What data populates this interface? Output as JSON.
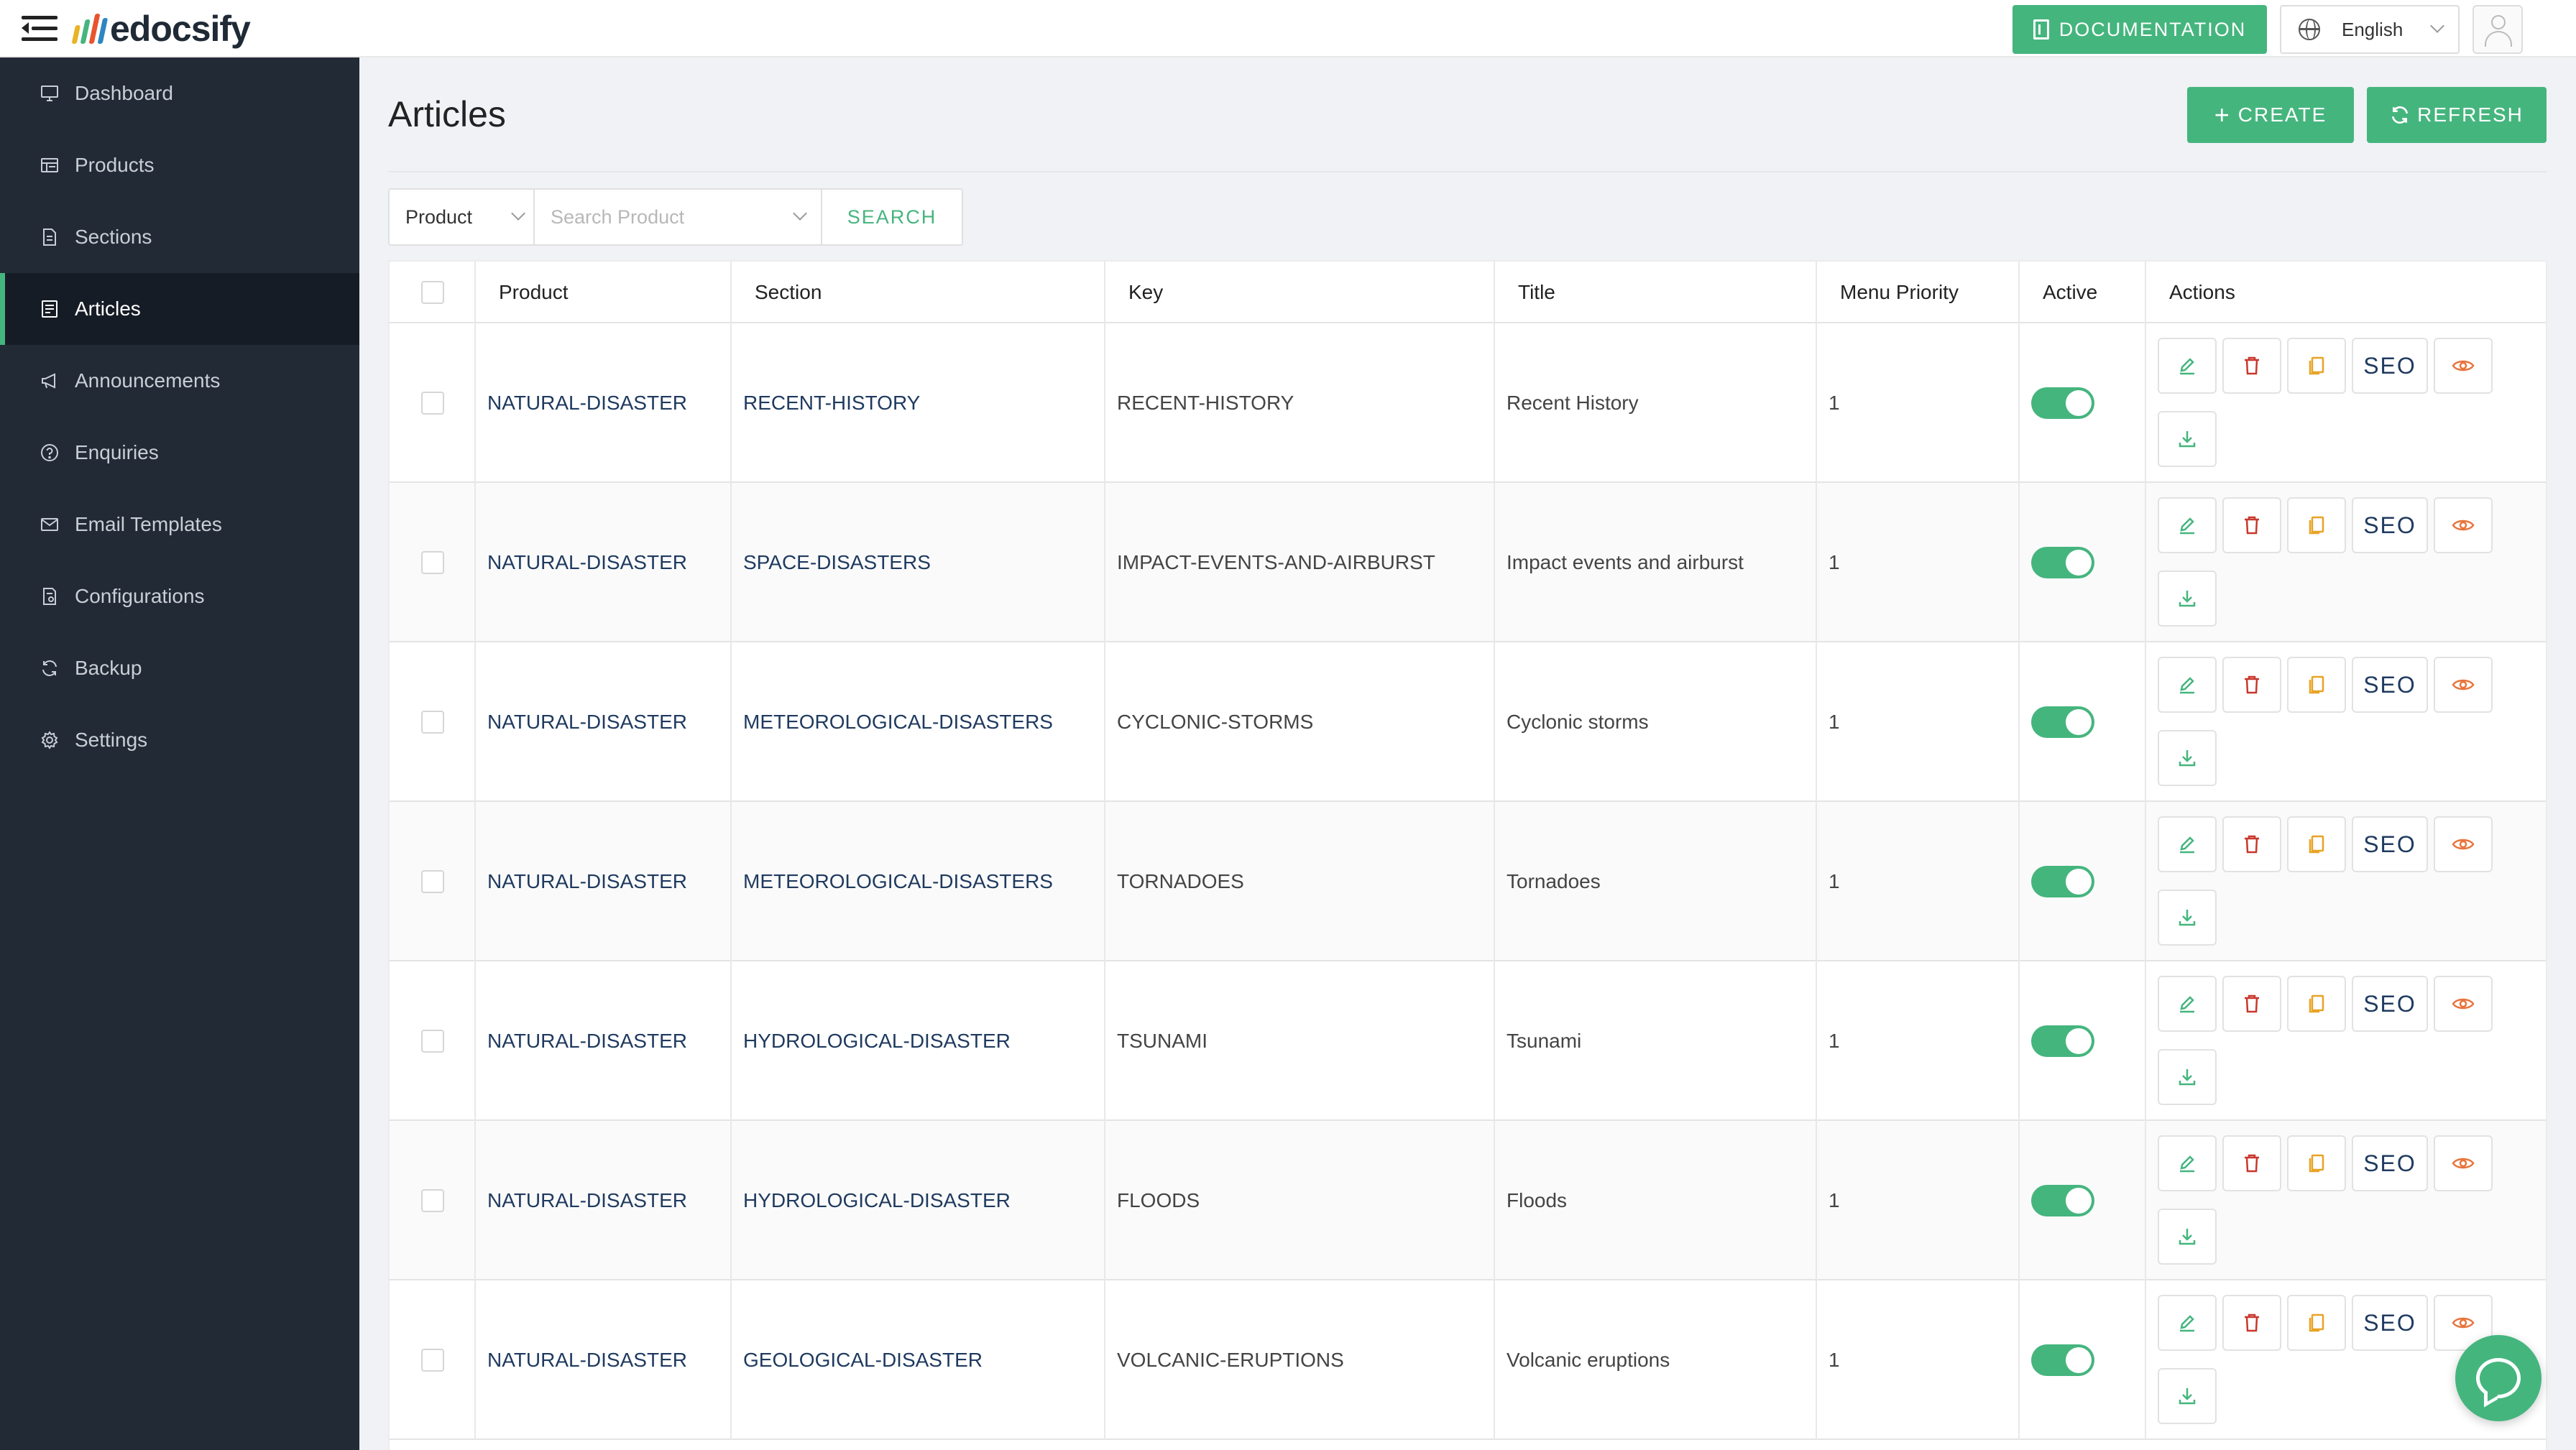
{
  "header": {
    "logo_text": "edocsify",
    "documentation_label": "DOCUMENTATION",
    "language": "English",
    "colors": {
      "brand": "#45b57e",
      "logo_bars": [
        "#e8b325",
        "#45b57e",
        "#e8542e",
        "#2e86c1"
      ]
    }
  },
  "sidebar": {
    "items": [
      {
        "label": "Dashboard",
        "icon": "monitor-icon"
      },
      {
        "label": "Products",
        "icon": "grid-list-icon"
      },
      {
        "label": "Sections",
        "icon": "document-icon"
      },
      {
        "label": "Articles",
        "icon": "article-icon",
        "active": true
      },
      {
        "label": "Announcements",
        "icon": "megaphone-icon"
      },
      {
        "label": "Enquiries",
        "icon": "question-circle-icon"
      },
      {
        "label": "Email Templates",
        "icon": "mail-icon"
      },
      {
        "label": "Configurations",
        "icon": "config-file-icon"
      },
      {
        "label": "Backup",
        "icon": "sync-icon"
      },
      {
        "label": "Settings",
        "icon": "gear-icon"
      }
    ]
  },
  "page": {
    "title": "Articles",
    "create_label": "CREATE",
    "refresh_label": "REFRESH"
  },
  "filter": {
    "field_selected": "Product",
    "search_placeholder": "Search Product",
    "search_label": "SEARCH"
  },
  "table": {
    "columns": [
      "Product",
      "Section",
      "Key",
      "Title",
      "Menu Priority",
      "Active",
      "Actions"
    ],
    "seo_label": "SEO",
    "rows": [
      {
        "product": "NATURAL-DISASTER",
        "section": "RECENT-HISTORY",
        "key": "RECENT-HISTORY",
        "title": "Recent History",
        "priority": "1",
        "active": true
      },
      {
        "product": "NATURAL-DISASTER",
        "section": "SPACE-DISASTERS",
        "key": "IMPACT-EVENTS-AND-AIRBURST",
        "title": "Impact events and airburst",
        "priority": "1",
        "active": true
      },
      {
        "product": "NATURAL-DISASTER",
        "section": "METEOROLOGICAL-DISASTERS",
        "key": "CYCLONIC-STORMS",
        "title": "Cyclonic storms",
        "priority": "1",
        "active": true
      },
      {
        "product": "NATURAL-DISASTER",
        "section": "METEOROLOGICAL-DISASTERS",
        "key": "TORNADOES",
        "title": "Tornadoes",
        "priority": "1",
        "active": true
      },
      {
        "product": "NATURAL-DISASTER",
        "section": "HYDROLOGICAL-DISASTER",
        "key": "TSUNAMI",
        "title": "Tsunami",
        "priority": "1",
        "active": true
      },
      {
        "product": "NATURAL-DISASTER",
        "section": "HYDROLOGICAL-DISASTER",
        "key": "FLOODS",
        "title": "Floods",
        "priority": "1",
        "active": true
      },
      {
        "product": "NATURAL-DISASTER",
        "section": "GEOLOGICAL-DISASTER",
        "key": "VOLCANIC-ERUPTIONS",
        "title": "Volcanic eruptions",
        "priority": "1",
        "active": true
      }
    ]
  }
}
